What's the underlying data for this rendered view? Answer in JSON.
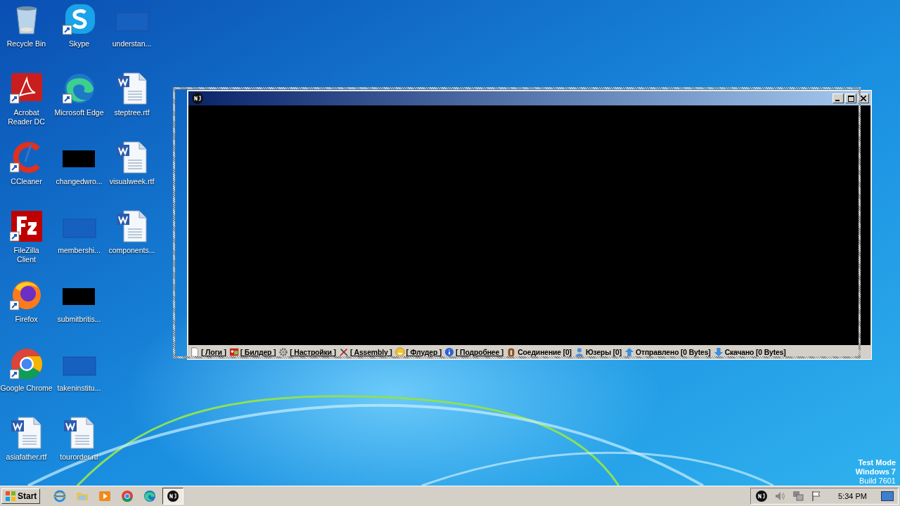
{
  "desktop_icons": [
    {
      "label": "Recycle Bin",
      "kind": "recycle"
    },
    {
      "label": "Acrobat Reader DC",
      "kind": "acrobat"
    },
    {
      "label": "CCleaner",
      "kind": "ccleaner"
    },
    {
      "label": "FileZilla Client",
      "kind": "filezilla"
    },
    {
      "label": "Firefox",
      "kind": "firefox"
    },
    {
      "label": "Google Chrome",
      "kind": "chrome"
    },
    {
      "label": "asiafather.rtf",
      "kind": "word"
    },
    {
      "label": "Skype",
      "kind": "skype"
    },
    {
      "label": "Microsoft Edge",
      "kind": "edge"
    },
    {
      "label": "changedwro...",
      "kind": "black"
    },
    {
      "label": "membershi...",
      "kind": "blank"
    },
    {
      "label": "submitbritis...",
      "kind": "black"
    },
    {
      "label": "takeninstitu...",
      "kind": "blank"
    },
    {
      "label": "tourorder.rtf",
      "kind": "word"
    },
    {
      "label": "understan...",
      "kind": "blank"
    },
    {
      "label": "steptree.rtf",
      "kind": "word"
    },
    {
      "label": "visualweek.rtf",
      "kind": "word"
    },
    {
      "label": "components...",
      "kind": "word"
    }
  ],
  "window": {
    "status_items": [
      {
        "label": "[ Логи ]",
        "kind": "doc",
        "underlined": true
      },
      {
        "label": "[ Билдер ]",
        "kind": "builder",
        "underlined": true
      },
      {
        "label": "[ Настройки ]",
        "kind": "gear",
        "underlined": true
      },
      {
        "label": "[ Assembly ]",
        "kind": "tools",
        "underlined": true
      },
      {
        "label": "[ Флудер ]",
        "kind": "smiley",
        "underlined": true
      },
      {
        "label": "[ Подробнее ]",
        "kind": "info",
        "underlined": true
      },
      {
        "label": "Соединение [0]",
        "kind": "plug",
        "underlined": false
      },
      {
        "label": "Юзеры [0]",
        "kind": "user",
        "underlined": false
      },
      {
        "label": "Отправлено [0 Bytes]",
        "kind": "up",
        "underlined": false
      },
      {
        "label": "Скачано [0 Bytes]",
        "kind": "down",
        "underlined": false
      }
    ]
  },
  "system_notice": [
    "Test Mode",
    "Windows 7",
    "Build 7601"
  ],
  "taskbar": {
    "start": "Start",
    "apps": [
      {
        "kind": "ie",
        "active": false
      },
      {
        "kind": "folder",
        "active": false
      },
      {
        "kind": "media",
        "active": false
      },
      {
        "kind": "chrome",
        "active": false
      },
      {
        "kind": "edge",
        "active": false
      },
      {
        "kind": "njrat",
        "active": true
      }
    ],
    "tray": [
      {
        "kind": "njrat"
      },
      {
        "kind": "speaker"
      },
      {
        "kind": "network"
      },
      {
        "kind": "flag"
      }
    ],
    "clock": "5:34 PM"
  }
}
